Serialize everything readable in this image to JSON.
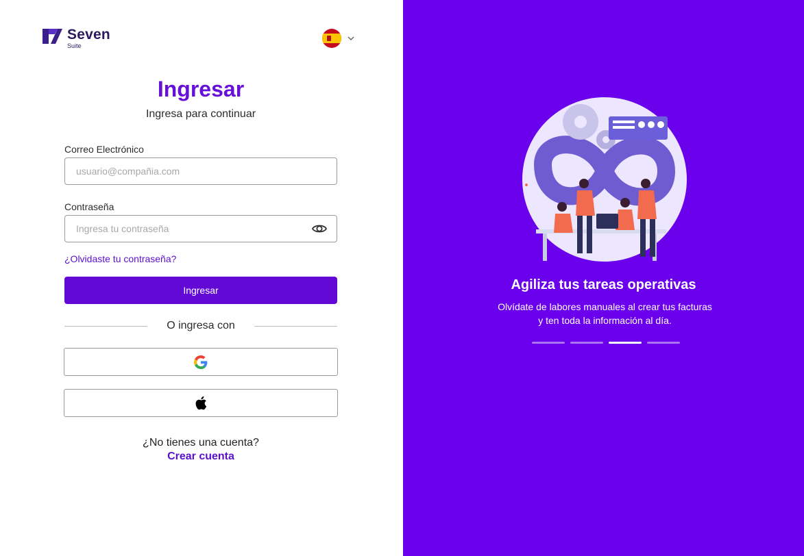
{
  "brand": {
    "name": "Seven",
    "sub": "Suite",
    "color": "#2a1a5e"
  },
  "language": {
    "flag_icon": "spain-flag-icon",
    "selector_icon": "chevron-down-icon"
  },
  "login": {
    "title": "Ingresar",
    "subtitle": "Ingresa para continuar",
    "email_label": "Correo Electrónico",
    "email_placeholder": "usuario@compañia.com",
    "password_label": "Contraseña",
    "password_placeholder": "Ingresa tu contraseña",
    "password_toggle_icon": "eye-icon",
    "forgot_link": "¿Olvidaste tu contraseña?",
    "submit_label": "Ingresar",
    "divider_text": "O ingresa con",
    "social": [
      {
        "icon": "google-icon"
      },
      {
        "icon": "apple-icon"
      }
    ],
    "no_account_text": "¿No tienes una cuenta?",
    "create_account_link": "Crear cuenta"
  },
  "promo": {
    "title": "Agiliza tus tareas operativas",
    "text_line1": "Olvídate de labores manuales al crear tus facturas",
    "text_line2": "y ten toda la información al día.",
    "slides_total": 4,
    "active_slide": 3
  },
  "colors": {
    "accent": "#6610d8",
    "primary_button": "#6309d6",
    "panel": "#6b00ec",
    "link": "#5a0fcf"
  }
}
